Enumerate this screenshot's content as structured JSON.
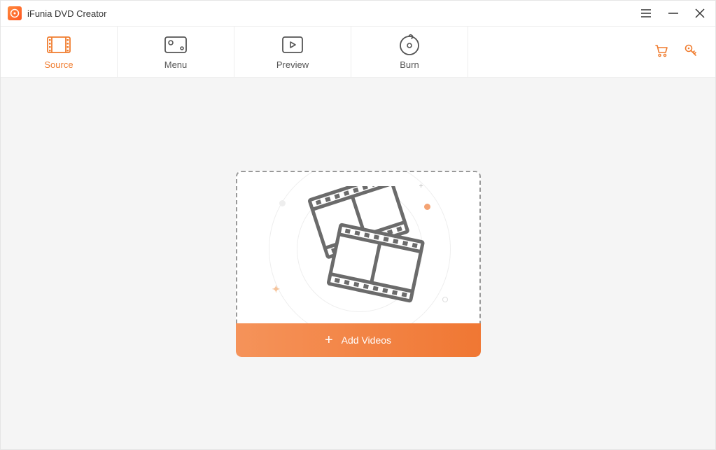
{
  "window": {
    "title": "iFunia DVD Creator"
  },
  "tabs": {
    "source": {
      "label": "Source"
    },
    "menu": {
      "label": "Menu"
    },
    "preview": {
      "label": "Preview"
    },
    "burn": {
      "label": "Burn"
    }
  },
  "main": {
    "addButtonLabel": "Add Videos"
  },
  "colors": {
    "accent": "#f07c2e",
    "iconGray": "#555"
  }
}
